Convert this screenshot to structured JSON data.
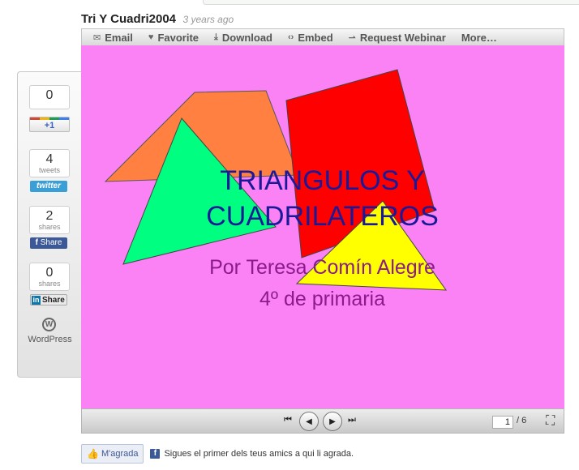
{
  "header": {
    "title": "Tri Y Cuadri2004",
    "time_ago": "3 years ago"
  },
  "toolbar": {
    "items": [
      {
        "label": "Email",
        "icon": "envelope-icon"
      },
      {
        "label": "Favorite",
        "icon": "heart-icon"
      },
      {
        "label": "Download",
        "icon": "download-icon"
      },
      {
        "label": "Embed",
        "icon": "embed-icon"
      },
      {
        "label": "Request Webinar",
        "icon": "webinar-icon"
      },
      {
        "label": "More…"
      }
    ]
  },
  "slide": {
    "background": "#fb82f5",
    "title_line1": "TRIANGULOS Y",
    "title_line2": "CUADRILATEROS",
    "author": "Por Teresa Comín Alegre",
    "grade": "4º de primaria",
    "colors": {
      "orange": "#ff8040",
      "green": "#00ff80",
      "red": "#ff0000",
      "yellow": "#ffff00",
      "title": "#1a1a99",
      "subtitle": "#8b1a8b"
    }
  },
  "player": {
    "current_page": "1",
    "total_pages": "/ 6"
  },
  "share": {
    "google": {
      "count": "0",
      "button": "+1"
    },
    "twitter": {
      "count": "4",
      "unit": "tweets",
      "button": "twitter"
    },
    "facebook": {
      "count": "2",
      "unit": "shares",
      "button": "Share"
    },
    "linkedin": {
      "count": "0",
      "unit": "shares",
      "button": "Share",
      "logo": "in"
    },
    "wordpress": {
      "label": "WordPress"
    }
  },
  "facebook_like": {
    "button": "M'agrada",
    "text": "Sigues el primer dels teus amics a qui li agrada."
  }
}
